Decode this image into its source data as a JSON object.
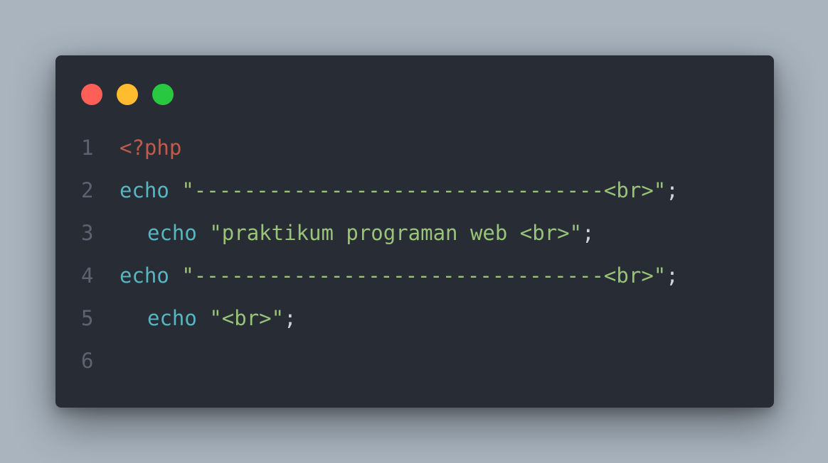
{
  "window": {
    "controls": [
      {
        "name": "close",
        "color": "#ff5f57"
      },
      {
        "name": "minimize",
        "color": "#febc2e"
      },
      {
        "name": "maximize",
        "color": "#28c840"
      }
    ]
  },
  "code": {
    "lines": [
      {
        "number": "1",
        "indent": false,
        "tokens": [
          {
            "type": "tag",
            "text": "<?php"
          }
        ]
      },
      {
        "number": "2",
        "indent": false,
        "tokens": [
          {
            "type": "kw",
            "text": "echo"
          },
          {
            "type": "punc",
            "text": " "
          },
          {
            "type": "str",
            "text": "\"---------------------------------<br>\""
          },
          {
            "type": "punc",
            "text": ";"
          }
        ]
      },
      {
        "number": "3",
        "indent": true,
        "tokens": [
          {
            "type": "kw",
            "text": "echo"
          },
          {
            "type": "punc",
            "text": " "
          },
          {
            "type": "str",
            "text": "\"praktikum programan web <br>\""
          },
          {
            "type": "punc",
            "text": ";"
          }
        ]
      },
      {
        "number": "4",
        "indent": false,
        "tokens": [
          {
            "type": "kw",
            "text": "echo"
          },
          {
            "type": "punc",
            "text": " "
          },
          {
            "type": "str",
            "text": "\"---------------------------------<br>\""
          },
          {
            "type": "punc",
            "text": ";"
          }
        ]
      },
      {
        "number": "5",
        "indent": true,
        "tokens": [
          {
            "type": "kw",
            "text": "echo"
          },
          {
            "type": "punc",
            "text": " "
          },
          {
            "type": "str",
            "text": "\"<br>\""
          },
          {
            "type": "punc",
            "text": ";"
          }
        ]
      },
      {
        "number": "6",
        "indent": false,
        "tokens": []
      }
    ]
  }
}
